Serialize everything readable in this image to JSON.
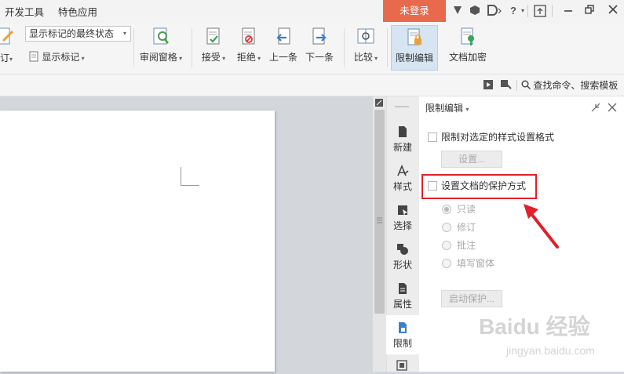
{
  "menubar": {
    "tabs": [
      "开发工具",
      "特色应用"
    ],
    "login_label": "未登录",
    "help_label": "?"
  },
  "ribbon": {
    "revise_label": "订",
    "status_select": "显示标记的最终状态",
    "show_markup_label": "显示标记",
    "review_pane_label": "审阅窗格",
    "accept_label": "接受",
    "reject_label": "拒绝",
    "prev_label": "上一条",
    "next_label": "下一条",
    "compare_label": "比较",
    "restrict_edit_label": "限制编辑",
    "doc_encrypt_label": "文档加密"
  },
  "cmdbar": {
    "search_label": "查找命令、搜索模板"
  },
  "rail": {
    "items": [
      {
        "label": "新建",
        "icon": "new-doc-icon"
      },
      {
        "label": "样式",
        "icon": "style-icon"
      },
      {
        "label": "选择",
        "icon": "select-icon"
      },
      {
        "label": "形状",
        "icon": "shape-icon"
      },
      {
        "label": "属性",
        "icon": "properties-icon"
      },
      {
        "label": "限制",
        "icon": "restrict-icon"
      }
    ]
  },
  "pane": {
    "title": "限制编辑",
    "restrict_format_label": "限制对选定的样式设置格式",
    "settings_button": "设置...",
    "set_protection_label": "设置文档的保护方式",
    "options": [
      "只读",
      "修订",
      "批注",
      "填写窗体"
    ],
    "start_protect_button": "启动保护...",
    "selected_option_index": 0
  },
  "watermark": {
    "line1": "Baidu 经验",
    "line2": "jingyan.baidu.com"
  },
  "colors": {
    "login_bg": "#e8694b",
    "highlight_box": "#e0202a",
    "arrow": "#e0202a",
    "active_ribbon": "#d7e4f2"
  }
}
